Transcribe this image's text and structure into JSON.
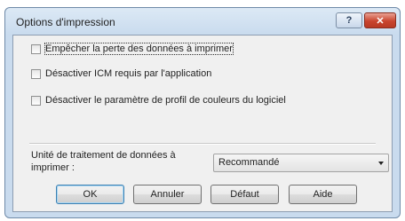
{
  "window": {
    "title": "Options d'impression",
    "help_button": "?",
    "close_button": "✕"
  },
  "options": [
    {
      "label": "Empêcher la perte des données à imprimer",
      "checked": false
    },
    {
      "label": "Désactiver ICM requis par l'application",
      "checked": false
    },
    {
      "label": "Désactiver le paramètre de profil de couleurs du logiciel",
      "checked": false
    }
  ],
  "processing_unit": {
    "label": "Unité de traitement de données à imprimer :",
    "selected": "Recommandé"
  },
  "buttons": {
    "ok": "OK",
    "cancel": "Annuler",
    "default": "Défaut",
    "help": "Aide"
  }
}
